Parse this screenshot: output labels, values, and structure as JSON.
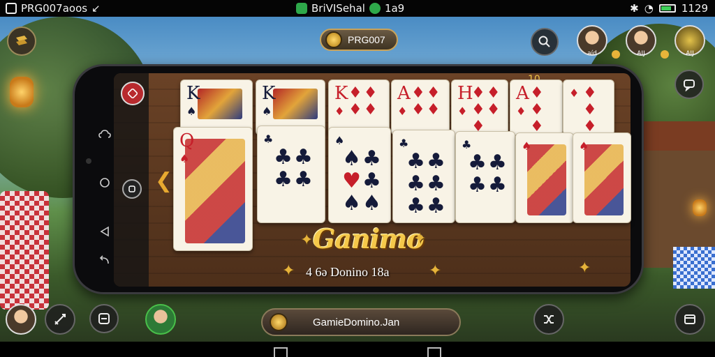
{
  "status_bar": {
    "left_text": "PRG007aoos",
    "center_text": "BriVISehal",
    "center_time": "1a9",
    "right_time": "1129"
  },
  "header": {
    "title": "PRG007"
  },
  "players": [
    {
      "label": "aíd"
    },
    {
      "label": "AIJ"
    },
    {
      "label": "AIJ"
    }
  ],
  "game": {
    "brand": "Ganimo",
    "subtitle": "4 6ə Donino 18a",
    "counter": "10",
    "top_row": [
      {
        "rank": "K",
        "suit": "♠",
        "color": "black",
        "type": "face"
      },
      {
        "rank": "K",
        "suit": "♠",
        "color": "black",
        "type": "face"
      },
      {
        "rank": "K",
        "suit": "♦",
        "color": "red",
        "type": "pips",
        "pips": [
          "♦",
          "♦",
          "♦",
          "♦"
        ]
      },
      {
        "rank": "A",
        "suit": "♦",
        "color": "red",
        "type": "pips",
        "pips": [
          "♦",
          "♦",
          "♦",
          "♦"
        ]
      },
      {
        "rank": "H",
        "suit": "♦",
        "color": "red",
        "type": "pips",
        "pips": [
          "♦",
          "♦",
          "♦",
          "♦",
          "♦"
        ]
      },
      {
        "rank": "A",
        "suit": "♦",
        "color": "red",
        "type": "pips",
        "pips": [
          "♦",
          "♦",
          "♦",
          "♦",
          "♦"
        ]
      },
      {
        "rank": "",
        "suit": "♦",
        "color": "red",
        "type": "pips",
        "pips": [
          "♦",
          "♦",
          "♦",
          "♦",
          "♦"
        ]
      }
    ],
    "bottom_row": [
      {
        "rank": "Q",
        "suit": "♠",
        "color": "red",
        "type": "face"
      },
      {
        "rank": "",
        "suit": "♣",
        "color": "black",
        "type": "pips",
        "pips": [
          "♣",
          "♣",
          "♣",
          "♣"
        ]
      },
      {
        "rank": "",
        "suit": "♠",
        "color": "black",
        "type": "pips",
        "pips": [
          "♠",
          "♣",
          "♥",
          "♣",
          "♠",
          "♠"
        ]
      },
      {
        "rank": "",
        "suit": "♣",
        "color": "black",
        "type": "pips",
        "pips": [
          "♣",
          "♣",
          "♣",
          "♣",
          "♣",
          "♣"
        ]
      },
      {
        "rank": "",
        "suit": "♣",
        "color": "black",
        "type": "pips",
        "pips": [
          "♣",
          "♣",
          "♣",
          "♣"
        ]
      },
      {
        "rank": "",
        "suit": "♠",
        "color": "red",
        "type": "face"
      },
      {
        "rank": "",
        "suit": "♠",
        "color": "red",
        "type": "face"
      }
    ]
  },
  "footer": {
    "label": "GamieDomino.Jan"
  },
  "icons": {
    "menu": "menu-icon",
    "search": "search-icon",
    "chat": "chat-icon",
    "settings": "settings-icon",
    "close": "close-icon",
    "back": "back-icon"
  },
  "colors": {
    "accent_gold": "#f5c84a",
    "card_red": "#c61f2a",
    "card_black": "#151b3a"
  }
}
